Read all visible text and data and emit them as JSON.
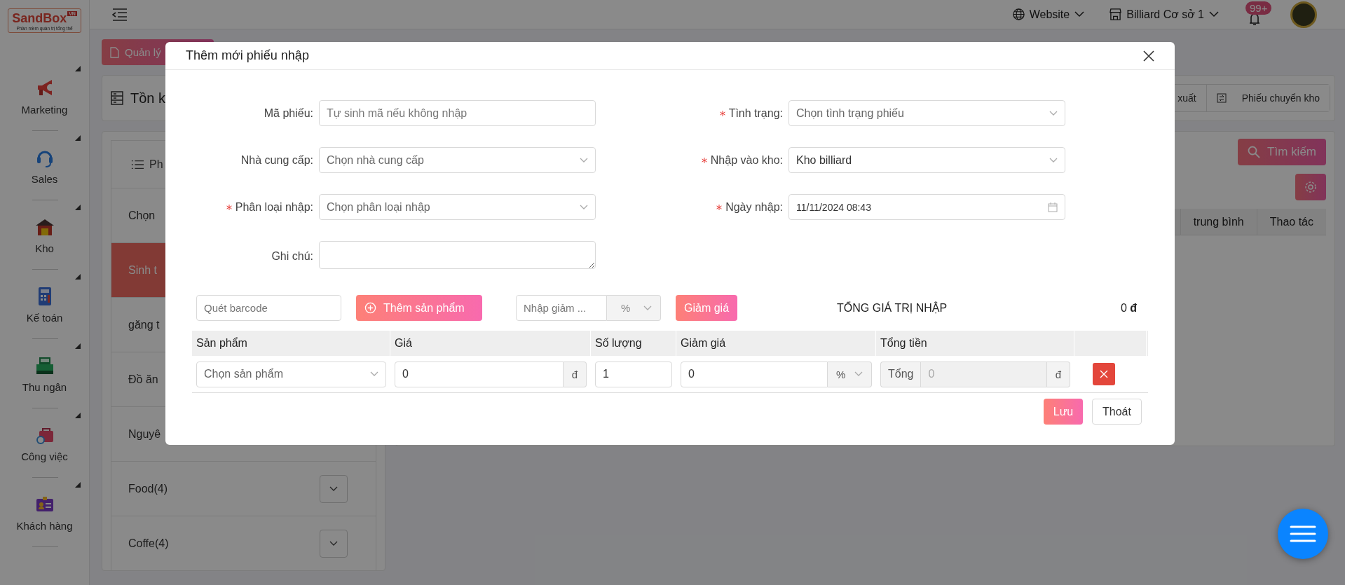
{
  "logo": {
    "name": "SandBox",
    "badge": "VN",
    "tagline": "Phần mềm quản trị tổng thể"
  },
  "sidebar": {
    "items": [
      {
        "label": "Marketing"
      },
      {
        "label": "Sales"
      },
      {
        "label": "Kho"
      },
      {
        "label": "Kế toán"
      },
      {
        "label": "Thu ngân"
      },
      {
        "label": "Công việc"
      },
      {
        "label": "Khách hàng"
      }
    ]
  },
  "header": {
    "website": "Website",
    "branch": "Billiard Cơ sở 1",
    "notifications": "99+"
  },
  "page": {
    "manage_button": "Quản lý",
    "stock_title": "Tồn k",
    "tabs": [
      "xuất",
      "Phiếu chuyển kho"
    ],
    "search_button": "Tìm kiếm",
    "category_header": "Ph",
    "categories": [
      {
        "label": "Chọn",
        "selected": false,
        "expandable": false
      },
      {
        "label": "Sinh t",
        "selected": true,
        "expandable": false
      },
      {
        "label": "găng t",
        "selected": false,
        "expandable": false
      },
      {
        "label": "Đồ ăn",
        "selected": false,
        "expandable": false
      },
      {
        "label": "Nguyê",
        "selected": false,
        "expandable": false
      },
      {
        "label": "Food(4)",
        "selected": false,
        "expandable": true
      },
      {
        "label": "Coffe(4)",
        "selected": false,
        "expandable": true
      }
    ],
    "table_columns": [
      "trung bình",
      "Thao tác"
    ]
  },
  "modal": {
    "title": "Thêm mới phiếu nhập",
    "left_fields": [
      {
        "label": "Mã phiếu:",
        "required": false,
        "kind": "text",
        "placeholder": "Tự sinh mã nếu không nhập"
      },
      {
        "label": "Nhà cung cấp:",
        "required": false,
        "kind": "select",
        "placeholder": "Chọn nhà cung cấp"
      },
      {
        "label": "Phân loại nhập:",
        "required": true,
        "kind": "select",
        "placeholder": "Chọn phân loại nhập"
      },
      {
        "label": "Ghi chú:",
        "required": false,
        "kind": "textarea"
      }
    ],
    "right_fields": [
      {
        "label": "Tình trạng:",
        "required": true,
        "kind": "select",
        "placeholder": "Chọn tình trạng phiếu"
      },
      {
        "label": "Nhập vào kho:",
        "required": true,
        "kind": "select",
        "value": "Kho billiard"
      },
      {
        "label": "Ngày nhập:",
        "required": true,
        "kind": "date",
        "value": "11/11/2024 08:43"
      }
    ],
    "barcode_placeholder": "Quét barcode",
    "add_product": "Thêm sản phẩm",
    "discount_placeholder": "Nhập giảm ...",
    "discount_unit": "%",
    "apply_discount": "Giảm giá",
    "total_label": "TỔNG GIÁ TRỊ NHẬP",
    "total_value": "0 **đ**",
    "columns": [
      "Sản phẩm",
      "Giá",
      "Số lượng",
      "Giảm giá",
      "Tổng tiền"
    ],
    "rows": [
      {
        "product_placeholder": "Chọn sản phẩm",
        "price": "0",
        "price_unit": "đ",
        "quantity": "1",
        "discount": "0",
        "discount_unit": "%",
        "total_label": "Tổng",
        "total": "0",
        "total_disabled": true,
        "total_unit": "đ"
      }
    ],
    "save": "Lưu",
    "cancel": "Thoát"
  }
}
